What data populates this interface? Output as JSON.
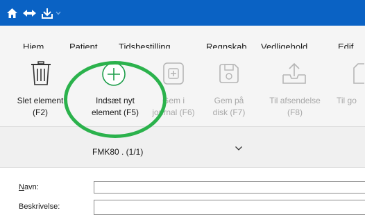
{
  "titlebar": {
    "icons": [
      "home-icon",
      "nav-arrows-icon",
      "customize-icon",
      "dropdown-arrow-icon"
    ]
  },
  "menu": {
    "items": [
      "Hjem",
      "Patient",
      "Tidsbestilling",
      "Regnskab",
      "Vedligehold",
      "Edif"
    ]
  },
  "ribbon": {
    "buttons": [
      {
        "label1": "Slet element",
        "label2": "(F2)",
        "icon": "trash-icon",
        "enabled": true
      },
      {
        "label1": "Indsæt nyt",
        "label2": "element (F5)",
        "icon": "add-circle-icon",
        "enabled": true
      },
      {
        "label1": "Gem i",
        "label2": "journal (F6)",
        "icon": "save-journal-icon",
        "enabled": false
      },
      {
        "label1": "Gem på",
        "label2": "disk (F7)",
        "icon": "save-disk-icon",
        "enabled": false
      },
      {
        "label1": "Til afsendelse",
        "label2": "(F8)",
        "icon": "send-outbox-icon",
        "enabled": false
      },
      {
        "label1": "Til go",
        "label2": "",
        "icon": "document-icon",
        "enabled": false
      }
    ]
  },
  "selector": {
    "value": "FMK80 . (1/1)",
    "icon": "chevron-down-icon"
  },
  "form": {
    "name_label": "Navn:",
    "name_accesskey": "N",
    "description_label": "Beskrivelse:",
    "name_value": "",
    "description_value": ""
  },
  "annotation": {
    "color": "#2bb24c"
  },
  "colors": {
    "titlebar": "#0a62c4",
    "ribbon_bg": "#f5f5f5",
    "disabled_text": "#a8a8a8",
    "accent_green": "#1e9e4a"
  }
}
